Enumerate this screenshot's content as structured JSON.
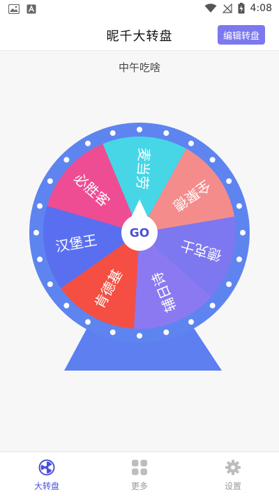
{
  "status_bar": {
    "time": "4:08"
  },
  "app_bar": {
    "title": "昵千大转盘",
    "edit_label": "编辑转盘"
  },
  "wheel": {
    "title": "中午吃啥",
    "center_label": "GO",
    "segments": [
      {
        "label": "全聚德",
        "color": "#f58c8c"
      },
      {
        "label": "德克士",
        "color": "#7d77f0"
      },
      {
        "label": "辅日诗",
        "color": "#8b79f2"
      },
      {
        "label": "肯德基",
        "color": "#f44f42"
      },
      {
        "label": "汉堡王",
        "color": "#5a6ff0"
      },
      {
        "label": "必胜客",
        "color": "#ee4d93"
      },
      {
        "label": "麦当劳",
        "color": "#46d6e6"
      }
    ],
    "rim_color": "#5e84ef",
    "stand_color": "#5e7ff0"
  },
  "tabs": [
    {
      "label": "大转盘",
      "icon": "wheel-icon",
      "active": true
    },
    {
      "label": "更多",
      "icon": "grid-icon",
      "active": false
    },
    {
      "label": "设置",
      "icon": "gear-icon",
      "active": false
    }
  ]
}
